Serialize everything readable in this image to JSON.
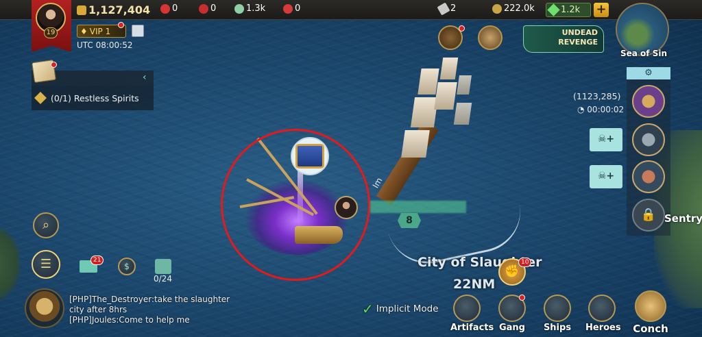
{
  "topbar": {
    "gold_total": "1,127,404",
    "res_a": "0",
    "res_b": "0",
    "res_c": "1.3k",
    "res_d": "0",
    "tickets": "2",
    "coins": "222.0k",
    "gems": "1.2k",
    "plus": "+"
  },
  "player": {
    "level": "19",
    "vip": "VIP 1",
    "utc": "UTC 08:00:52"
  },
  "quest": {
    "text": "(0/1) Restless Spirits"
  },
  "minimap": {
    "label": "Sea of Sin"
  },
  "event": {
    "title_line1": "UNDEAD",
    "title_line2": "REVENGE"
  },
  "fleet": {
    "coords": "(1123,285)",
    "timer": "00:00:02",
    "sentry": "Sentry"
  },
  "map": {
    "fleet_level": "8",
    "city": "City of Slaughter",
    "distance": "22NM",
    "fist_badge": "10"
  },
  "left_tools": {
    "mail_badge": "21",
    "cargo": "0/24"
  },
  "chat": {
    "line1": "[PHP]The_Destroyer:take the slaughter",
    "line2": "city after 8hrs",
    "line3": "[PHP]Joules:Come to help me"
  },
  "bottom_nav": {
    "implicit_mode": "Implicit Mode",
    "items": [
      {
        "label": "Artifacts"
      },
      {
        "label": "Gang"
      },
      {
        "label": "Ships"
      },
      {
        "label": "Heroes"
      },
      {
        "label": "Conch"
      }
    ]
  },
  "colors": {
    "accent_gold": "#d9b55b",
    "alert_red": "#e41a1a",
    "sea": "#1d4a70"
  }
}
